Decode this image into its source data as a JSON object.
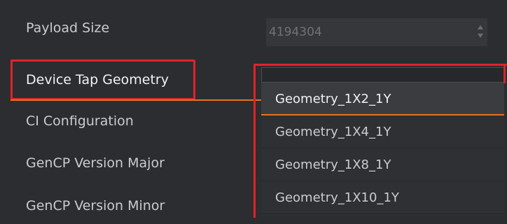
{
  "properties": [
    {
      "label": "Payload Size",
      "value": "4194304"
    },
    {
      "label": "Device Tap Geometry"
    },
    {
      "label": "CI Configuration"
    },
    {
      "label": "GenCP Version Major"
    },
    {
      "label": "GenCP Version Minor"
    }
  ],
  "dropdown": {
    "options": [
      "Geometry_1X2_1Y",
      "Geometry_1X4_1Y",
      "Geometry_1X8_1Y",
      "Geometry_1X10_1Y"
    ],
    "selected_index": 0
  },
  "colors": {
    "highlight_box": "#e0232a",
    "accent_line": "#e8731c",
    "background": "#2b2d30"
  }
}
